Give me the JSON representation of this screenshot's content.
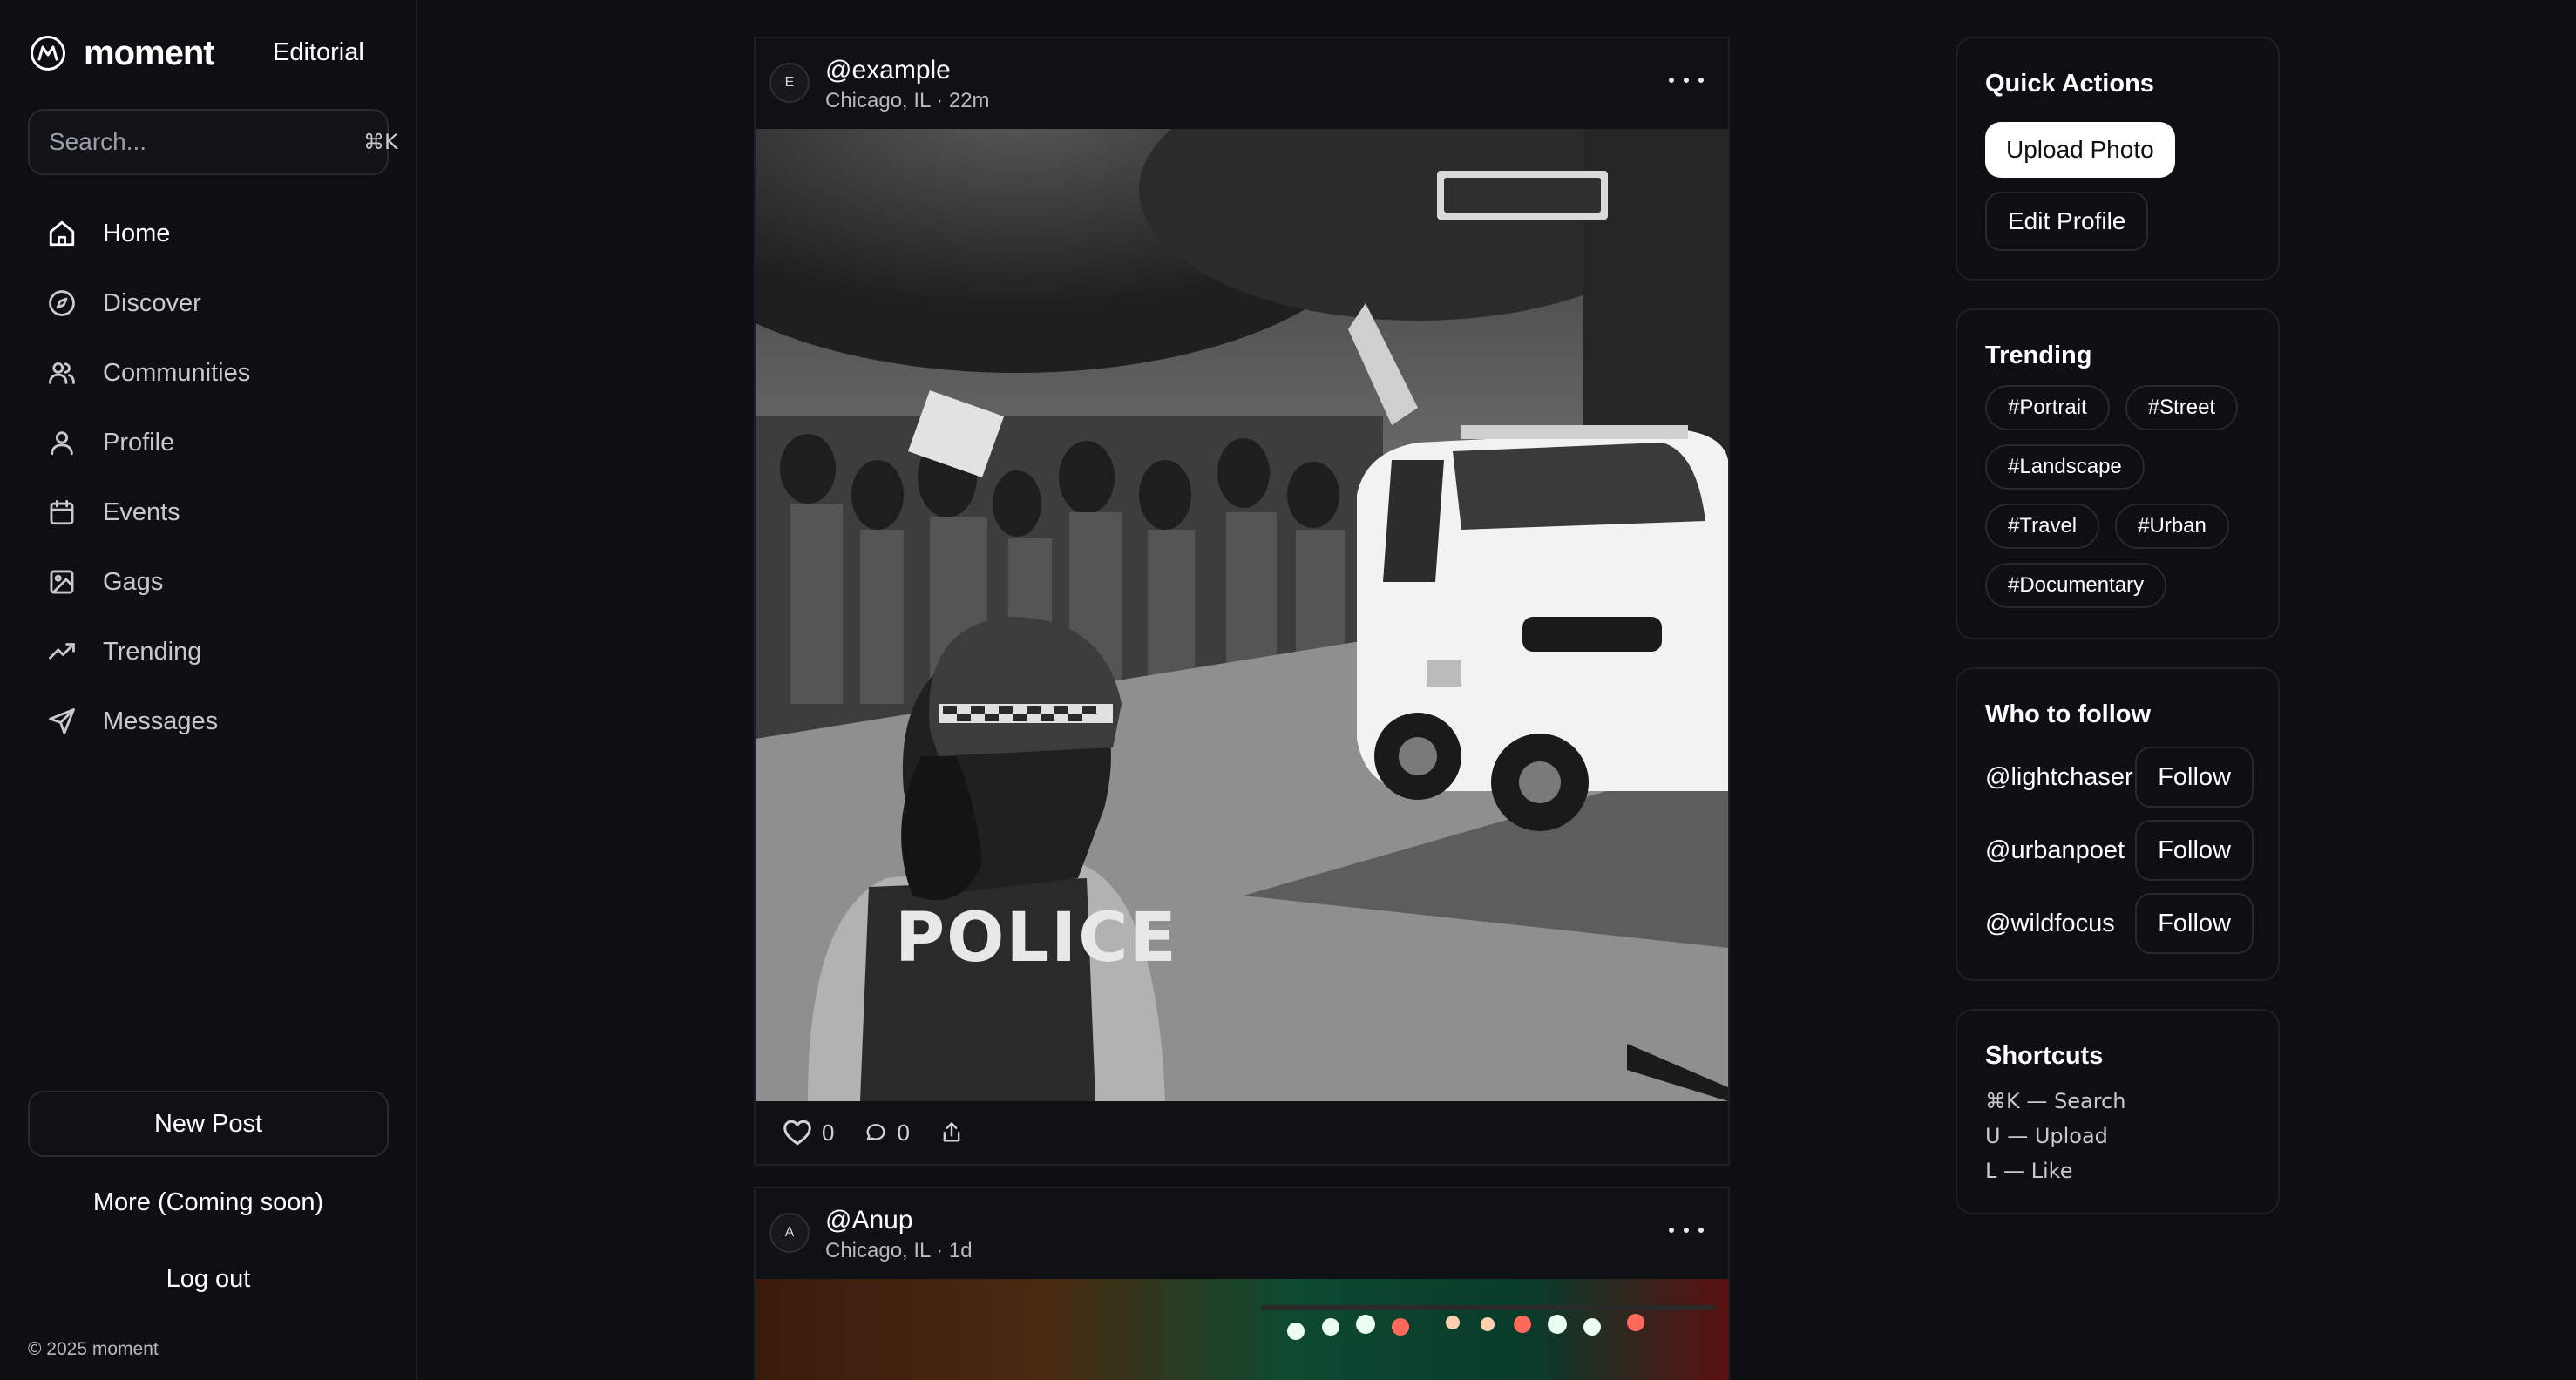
{
  "brand": {
    "name": "moment",
    "mode": "Editorial"
  },
  "search": {
    "placeholder": "Search...",
    "shortcut": "⌘K"
  },
  "nav": {
    "items": [
      {
        "label": "Home",
        "icon": "home-icon"
      },
      {
        "label": "Discover",
        "icon": "compass-icon"
      },
      {
        "label": "Communities",
        "icon": "users-icon"
      },
      {
        "label": "Profile",
        "icon": "user-icon"
      },
      {
        "label": "Events",
        "icon": "calendar-icon"
      },
      {
        "label": "Gags",
        "icon": "image-icon"
      },
      {
        "label": "Trending",
        "icon": "trending-icon"
      },
      {
        "label": "Messages",
        "icon": "send-icon"
      }
    ],
    "active": "Home"
  },
  "sidebar_footer": {
    "new_post": "New Post",
    "more": "More (Coming soon)",
    "logout": "Log out",
    "copyright": "© 2025 moment"
  },
  "posts": [
    {
      "avatar": "E",
      "handle": "@example",
      "meta": "Chicago, IL · 22m",
      "likes": "0",
      "comments": "0",
      "photo": "Black and white street photo: police officer in helmet and vest watching a protest march beside a police SUV"
    },
    {
      "avatar": "A",
      "handle": "@Anup",
      "meta": "Chicago, IL · 1d",
      "photo": "Concert stage with green and red lights"
    }
  ],
  "quick_actions": {
    "title": "Quick Actions",
    "upload": "Upload Photo",
    "edit": "Edit Profile"
  },
  "trending": {
    "title": "Trending",
    "tags": [
      "#Portrait",
      "#Street",
      "#Landscape",
      "#Travel",
      "#Urban",
      "#Documentary"
    ]
  },
  "who_to_follow": {
    "title": "Who to follow",
    "users": [
      {
        "handle": "@lightchaser",
        "button": "Follow"
      },
      {
        "handle": "@urbanpoet",
        "button": "Follow"
      },
      {
        "handle": "@wildfocus",
        "button": "Follow"
      }
    ]
  },
  "shortcuts": {
    "title": "Shortcuts",
    "items": [
      "⌘K — Search",
      "U — Upload",
      "L — Like"
    ]
  },
  "colors": {
    "background": "#0d0f12",
    "border": "#1d2026",
    "text": "#ffffff",
    "muted": "#b5bac1"
  }
}
